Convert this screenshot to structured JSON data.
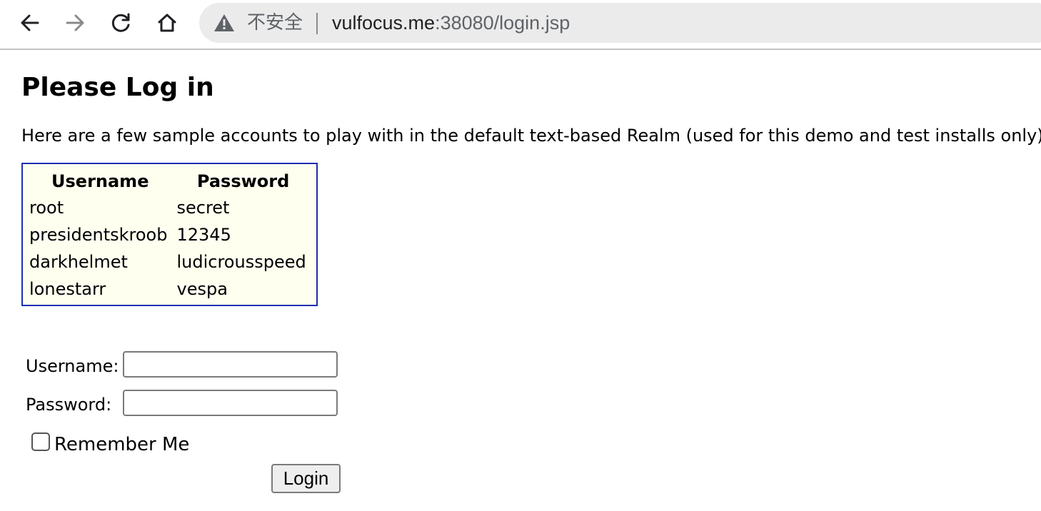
{
  "browser": {
    "back_icon": "arrow-left-icon",
    "forward_icon": "arrow-right-icon",
    "reload_icon": "reload-icon",
    "home_icon": "home-icon",
    "security_icon": "warning-triangle-icon",
    "security_label": "不安全",
    "url_host": "vulfocus.me",
    "url_rest": ":38080/login.jsp"
  },
  "page": {
    "title": "Please Log in",
    "intro": "Here are a few sample accounts to play with in the default text-based Realm (used for this demo and test installs only). Do"
  },
  "accounts_table": {
    "headers": [
      "Username",
      "Password"
    ],
    "rows": [
      [
        "root",
        "secret"
      ],
      [
        "presidentskroob",
        "12345"
      ],
      [
        "darkhelmet",
        "ludicrousspeed"
      ],
      [
        "lonestarr",
        "vespa"
      ]
    ],
    "border_color": "#1c2fb2",
    "background_color": "#fffff0"
  },
  "form": {
    "username_label": "Username:",
    "username_value": "",
    "password_label": "Password:",
    "password_value": "",
    "remember_label": "Remember Me",
    "remember_checked": false,
    "submit_label": "Login"
  }
}
